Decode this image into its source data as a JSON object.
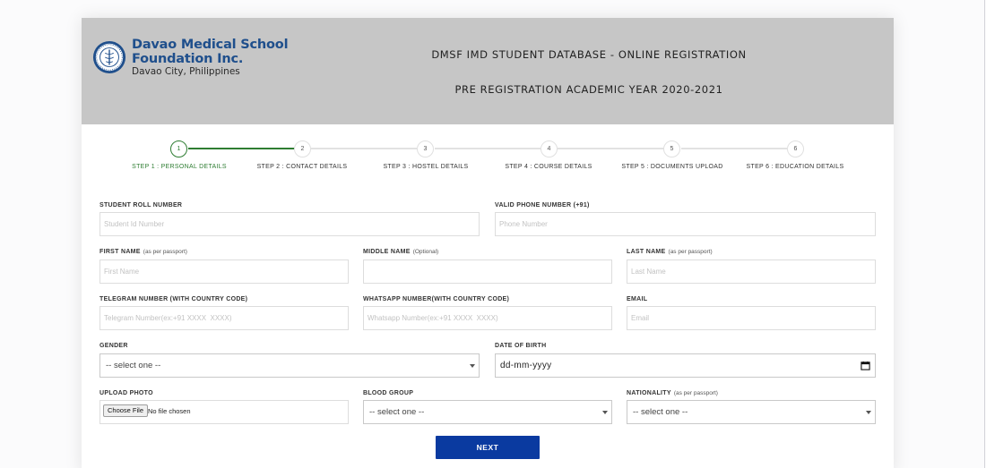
{
  "header": {
    "org_line1": "Davao Medical School",
    "org_line2": "Foundation Inc.",
    "org_line3": "Davao City, Philippines",
    "title": "DMSF IMD STUDENT DATABASE - ONLINE REGISTRATION",
    "subtitle": "PRE REGISTRATION ACADEMIC YEAR 2020-2021"
  },
  "stepper": {
    "steps": [
      {
        "number": "1",
        "label": "STEP 1 : PERSONAL DETAILS"
      },
      {
        "number": "2",
        "label": "STEP 2 : CONTACT DETAILS"
      },
      {
        "number": "3",
        "label": "STEP 3 : HOSTEL DETAILS"
      },
      {
        "number": "4",
        "label": "STEP 4 : COURSE DETAILS"
      },
      {
        "number": "5",
        "label": "STEP 5 : DOCUMENTS UPLOAD"
      },
      {
        "number": "6",
        "label": "STEP 6 : EDUCATION DETAILS"
      }
    ]
  },
  "form": {
    "student_roll": {
      "label": "STUDENT ROLL NUMBER",
      "placeholder": "Student Id Number"
    },
    "phone": {
      "label": "VALID PHONE NUMBER (+91)",
      "placeholder": "Phone Number"
    },
    "first_name": {
      "label": "FIRST NAME",
      "hint": "(as per passport)",
      "placeholder": "First Name"
    },
    "middle_name": {
      "label": "MIDDLE NAME",
      "hint": "(Optional)",
      "placeholder": ""
    },
    "last_name": {
      "label": "LAST NAME",
      "hint": "(as per passport)",
      "placeholder": "Last Name"
    },
    "telegram": {
      "label": "TELEGRAM NUMBER (WITH COUNTRY CODE)",
      "placeholder": "Telegram Number(ex:+91 XXXX  XXXX)"
    },
    "whatsapp": {
      "label": "WHATSAPP NUMBER(WITH COUNTRY CODE)",
      "placeholder": "Whatsapp Number(ex:+91 XXXX  XXXX)"
    },
    "email": {
      "label": "EMAIL",
      "placeholder": "Email"
    },
    "gender": {
      "label": "GENDER",
      "selected": "-- select one --"
    },
    "dob": {
      "label": "DATE OF BIRTH",
      "value": "dd-mm-yyyy"
    },
    "photo": {
      "label": "UPLOAD PHOTO",
      "button": "Choose File",
      "status": "No file chosen"
    },
    "blood_group": {
      "label": "BLOOD GROUP",
      "selected": "-- select one --"
    },
    "nationality": {
      "label": "NATIONALITY",
      "hint": "(as per passport)",
      "selected": "-- select one --"
    },
    "next_label": "NEXT"
  },
  "colors": {
    "brand_blue": "#1f4f8c",
    "active_step": "#2e7d32",
    "next_button": "#0a3aa0",
    "header_bg": "#c6c6c6"
  }
}
